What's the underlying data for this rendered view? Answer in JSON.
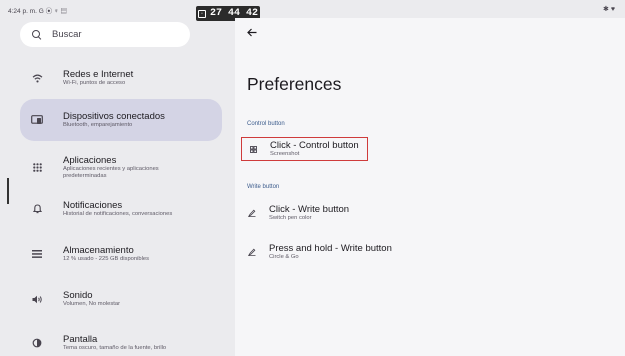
{
  "status_bar": {
    "left_text": "4:24 p. m. G ⦿ ♆ ▤",
    "right_text": "✱ ♥"
  },
  "recording_chip": {
    "icon": "screen-record-icon",
    "time": "27 44 42"
  },
  "search": {
    "placeholder": "Buscar"
  },
  "nav": [
    {
      "icon": "wifi-icon",
      "title": "Redes e Internet",
      "subtitle": "Wi-Fi, puntos de acceso"
    },
    {
      "icon": "connected-devices-icon",
      "title": "Dispositivos conectados",
      "subtitle": "Bluetooth, emparejamiento",
      "selected": true
    },
    {
      "icon": "apps-grid-icon",
      "title": "Aplicaciones",
      "subtitle": "Aplicaciones recientes y aplicaciones predeterminadas"
    },
    {
      "icon": "bell-icon",
      "title": "Notificaciones",
      "subtitle": "Historial de notificaciones, conversaciones"
    },
    {
      "icon": "storage-icon",
      "title": "Almacenamiento",
      "subtitle": "12 % usado - 225 GB disponibles"
    },
    {
      "icon": "speaker-icon",
      "title": "Sonido",
      "subtitle": "Volumen, No molestar"
    },
    {
      "icon": "display-icon",
      "title": "Pantalla",
      "subtitle": "Tema oscuro, tamaño de la fuente, brillo"
    }
  ],
  "detail": {
    "title": "Preferences",
    "sections": [
      {
        "header": "Control button",
        "items": [
          {
            "icon": "grid-icon",
            "title": "Click - Control button",
            "subtitle": "Screenshot"
          }
        ]
      },
      {
        "header": "Write button",
        "items": [
          {
            "icon": "pen-icon",
            "title": "Click - Write button",
            "subtitle": "Switch pen color"
          },
          {
            "icon": "pen-icon",
            "title": "Press and hold - Write button",
            "subtitle": "Circle & Go"
          }
        ]
      }
    ]
  },
  "colors": {
    "selected_bg": "#d4d4e5",
    "section_header": "#3b5b8c",
    "highlight_border": "#cf3b3b"
  }
}
